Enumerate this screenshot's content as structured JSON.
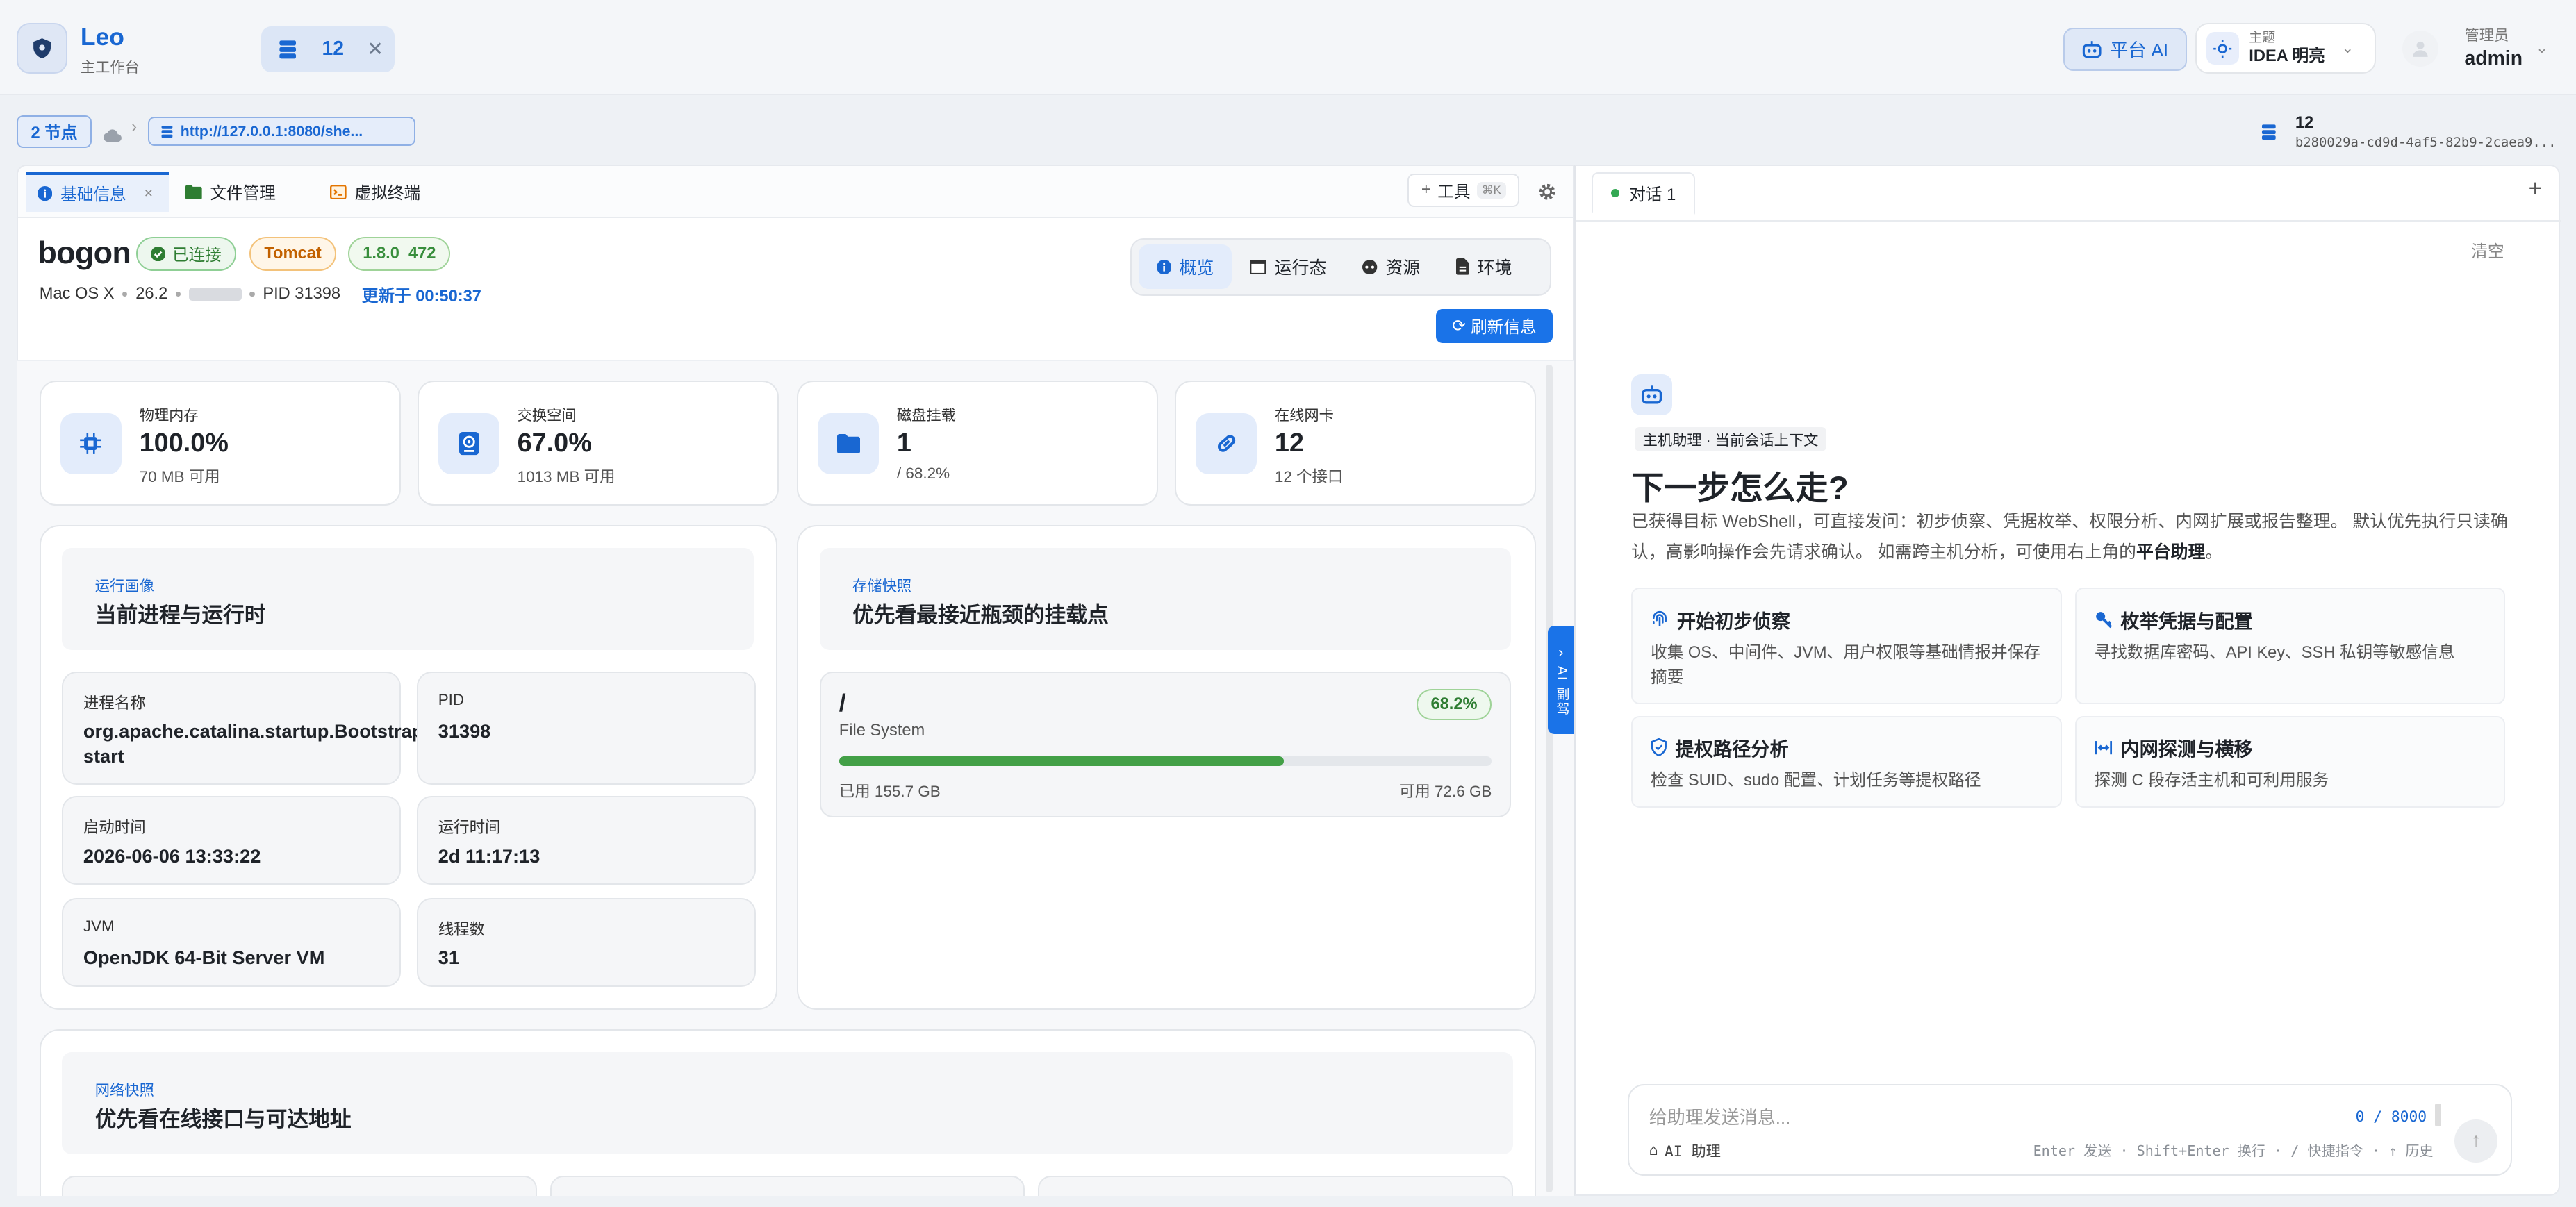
{
  "app": {
    "title": "Leo",
    "subtitle": "主工作台"
  },
  "session_tab": {
    "count": "12",
    "close": "✕"
  },
  "topbar": {
    "ai_label": "平台 AI",
    "theme_label": "主题",
    "theme_value": "IDEA 明亮",
    "user_role": "管理员",
    "user_name": "admin"
  },
  "breadcrumb": {
    "nodes": "2 节点",
    "sep": "›",
    "url": "http://127.0.0.1:8080/she..."
  },
  "session_info": {
    "id": "12",
    "uuid": "b280029a-cd9d-4af5-82b9-2caea9..."
  },
  "tabs": [
    {
      "label": "基础信息",
      "close": "×"
    },
    {
      "label": "文件管理"
    },
    {
      "label": "虚拟终端"
    }
  ],
  "toolbar": {
    "tools_label": "工具",
    "tools_shortcut": "⌘K"
  },
  "host": {
    "name": "bogon",
    "status": "已连接",
    "server": "Tomcat",
    "java": "1.8.0_472",
    "os": "Mac OS X",
    "os_version": "26.2",
    "pid": "PID 31398",
    "updated": "更新于 00:50:37"
  },
  "views": [
    "概览",
    "运行态",
    "资源",
    "环境"
  ],
  "refresh_label": "刷新信息",
  "stats": [
    {
      "label": "物理内存",
      "value": "100.0%",
      "sub": "70 MB 可用"
    },
    {
      "label": "交换空间",
      "value": "67.0%",
      "sub": "1013 MB 可用"
    },
    {
      "label": "磁盘挂载",
      "value": "1",
      "sub": "/ 68.2%"
    },
    {
      "label": "在线网卡",
      "value": "12",
      "sub": "12 个接口"
    }
  ],
  "runtime": {
    "kicker": "运行画像",
    "title": "当前进程与运行时",
    "fields": [
      {
        "label": "进程名称",
        "value": "org.apache.catalina.startup.Bootstrap start"
      },
      {
        "label": "PID",
        "value": "31398"
      },
      {
        "label": "启动时间",
        "value": "2026-06-06 13:33:22"
      },
      {
        "label": "运行时间",
        "value": "2d 11:17:13"
      },
      {
        "label": "JVM",
        "value": "OpenJDK 64-Bit Server VM"
      },
      {
        "label": "线程数",
        "value": "31"
      }
    ]
  },
  "storage": {
    "kicker": "存储快照",
    "title": "优先看最接近瓶颈的挂载点",
    "mount": "/",
    "fs": "File System",
    "percent_label": "68.2%",
    "used_fraction": 0.682,
    "used": "已用 155.7 GB",
    "free": "可用 72.6 GB"
  },
  "network": {
    "kicker": "网络快照",
    "title": "优先看在线接口与可达地址"
  },
  "ai_side_tab": "AI 副驾",
  "chat": {
    "tab": "对话 1",
    "add": "+",
    "clear": "清空",
    "context_tag": "主机助理 · 当前会话上下文",
    "heading": "下一步怎么走?",
    "intro": "已获得目标 WebShell，可直接发问：初步侦察、凭据枚举、权限分析、内网扩展或报告整理。 默认优先执行只读确认，高影响操作会先请求确认。 如需跨主机分析，可使用右上角的",
    "intro_link": "平台助理",
    "intro_end": "。",
    "suggestions": [
      {
        "title": "开始初步侦察",
        "desc": "收集 OS、中间件、JVM、用户权限等基础情报并保存摘要",
        "icon": "fingerprint-icon"
      },
      {
        "title": "枚举凭据与配置",
        "desc": "寻找数据库密码、API Key、SSH 私钥等敏感信息",
        "icon": "key-icon"
      },
      {
        "title": "提权路径分析",
        "desc": "检查 SUID、sudo 配置、计划任务等提权路径",
        "icon": "shield-icon"
      },
      {
        "title": "内网探测与横移",
        "desc": "探测 C 段存活主机和可利用服务",
        "icon": "network-icon"
      }
    ],
    "input_placeholder": "给助理发送消息...",
    "counter": "0 / 8000",
    "mode": "AI 助理",
    "hints": "Enter 发送 · Shift+Enter 换行 · / 快捷指令 · ↑ 历史"
  },
  "colors": {
    "accent": "#1967d2",
    "button": "#1a73e8",
    "success": "#34a853",
    "warning": "#e37400"
  }
}
